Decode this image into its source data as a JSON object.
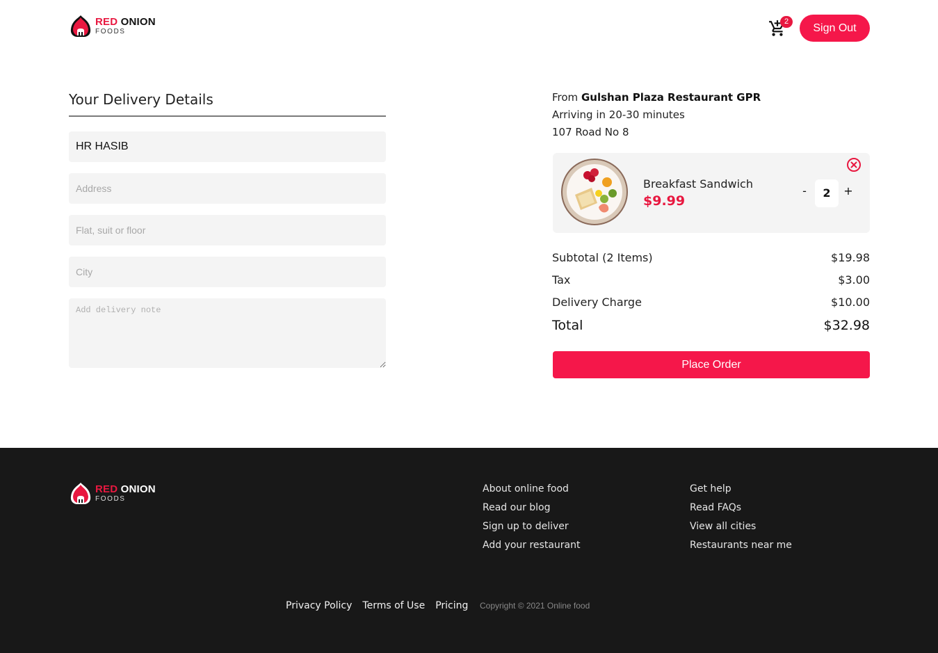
{
  "brand": {
    "name_red": "RED",
    "name_dark": "ONION",
    "tagline": "FOODS",
    "accent_color": "#e81840"
  },
  "header": {
    "cart_icon": "cart-plus-icon",
    "cart_count": "2",
    "signout_label": "Sign Out"
  },
  "delivery": {
    "title": "Your Delivery Details",
    "name_value": "HR HASIB",
    "address_placeholder": "Address",
    "flat_placeholder": "Flat, suit or floor",
    "city_placeholder": "City",
    "note_placeholder": "Add delivery note"
  },
  "order": {
    "from_label": "From",
    "restaurant": "Gulshan Plaza Restaurant GPR",
    "arriving": "Arriving in 20-30 minutes",
    "address": "107 Road No 8",
    "item": {
      "name": "Breakfast Sandwich",
      "price": "$9.99",
      "quantity": "2",
      "minus": "-",
      "plus": "+"
    },
    "summary": {
      "subtotal_label": "Subtotal (2 Items)",
      "subtotal_value": "$19.98",
      "tax_label": "Tax",
      "tax_value": "$3.00",
      "delivery_label": "Delivery Charge",
      "delivery_value": "$10.00",
      "total_label": "Total",
      "total_value": "$32.98"
    },
    "place_order_label": "Place Order"
  },
  "footer": {
    "col1": [
      "About online food",
      "Read our blog",
      "Sign up to deliver",
      "Add your restaurant"
    ],
    "col2": [
      "Get help",
      "Read FAQs",
      "View all cities",
      "Restaurants near me"
    ],
    "bottom_links": [
      "Privacy Policy",
      "Terms of Use",
      "Pricing"
    ],
    "copyright": "Copyright © 2021 Online food"
  }
}
